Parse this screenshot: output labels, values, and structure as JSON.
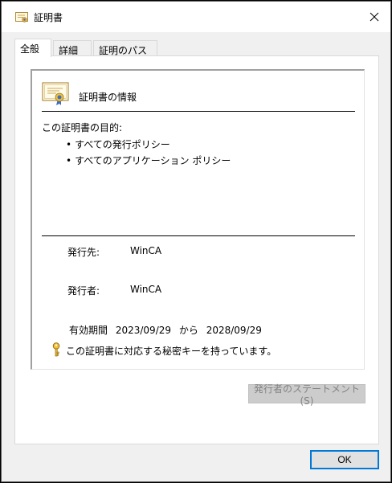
{
  "window": {
    "title": "証明書",
    "close_glyph": "✕"
  },
  "tabs": [
    {
      "label": "全般",
      "active": true
    },
    {
      "label": "詳細",
      "active": false
    },
    {
      "label": "証明のパス",
      "active": false
    }
  ],
  "general": {
    "heading": "証明書の情報",
    "purpose_label": "この証明書の目的:",
    "purposes": [
      "すべての発行ポリシー",
      "すべてのアプリケーション ポリシー"
    ],
    "issued_to_label": "発行先:",
    "issued_to_value": "WinCA",
    "issued_by_label": "発行者:",
    "issued_by_value": "WinCA",
    "validity_label": "有効期間",
    "valid_from": "2023/09/29",
    "validity_from_word": "から",
    "valid_to": "2028/09/29",
    "private_key_note": "この証明書に対応する秘密キーを持っています。"
  },
  "buttons": {
    "issuer_statement": "発行者のステートメント(S)",
    "ok": "OK"
  },
  "icons": {
    "title": "certificate-icon",
    "heading": "certificate-icon",
    "key": "key-icon"
  },
  "colors": {
    "focus_border": "#0078d7",
    "disabled_text": "#838383"
  }
}
